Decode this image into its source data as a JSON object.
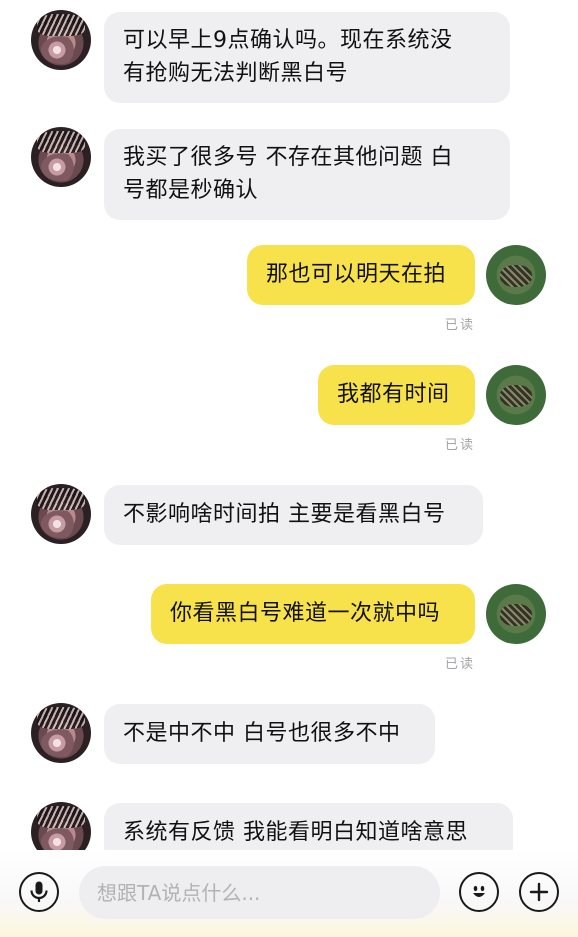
{
  "messages": [
    {
      "side": "left",
      "lines": [
        "可以早上9点确认吗。现在系统没",
        "有抢购无法判断黑白号"
      ]
    },
    {
      "side": "left",
      "lines": [
        "我买了很多号 不存在其他问题 白",
        "号都是秒确认"
      ]
    },
    {
      "side": "right",
      "text": "那也可以明天在拍",
      "status": "已读"
    },
    {
      "side": "right",
      "text": "我都有时间",
      "status": "已读"
    },
    {
      "side": "left",
      "text": "不影响啥时间拍 主要是看黑白号"
    },
    {
      "side": "right",
      "text": "你看黑白号难道一次就中吗",
      "status": "已读"
    },
    {
      "side": "left",
      "text": "不是中不中 白号也很多不中"
    },
    {
      "side": "left",
      "text": "系统有反馈 我能看明白知道啥意思"
    }
  ],
  "input": {
    "placeholder": "想跟TA说点什么..."
  },
  "icons": {
    "voice": "microphone-icon",
    "emoji": "smiley-icon",
    "more": "plus-icon"
  }
}
